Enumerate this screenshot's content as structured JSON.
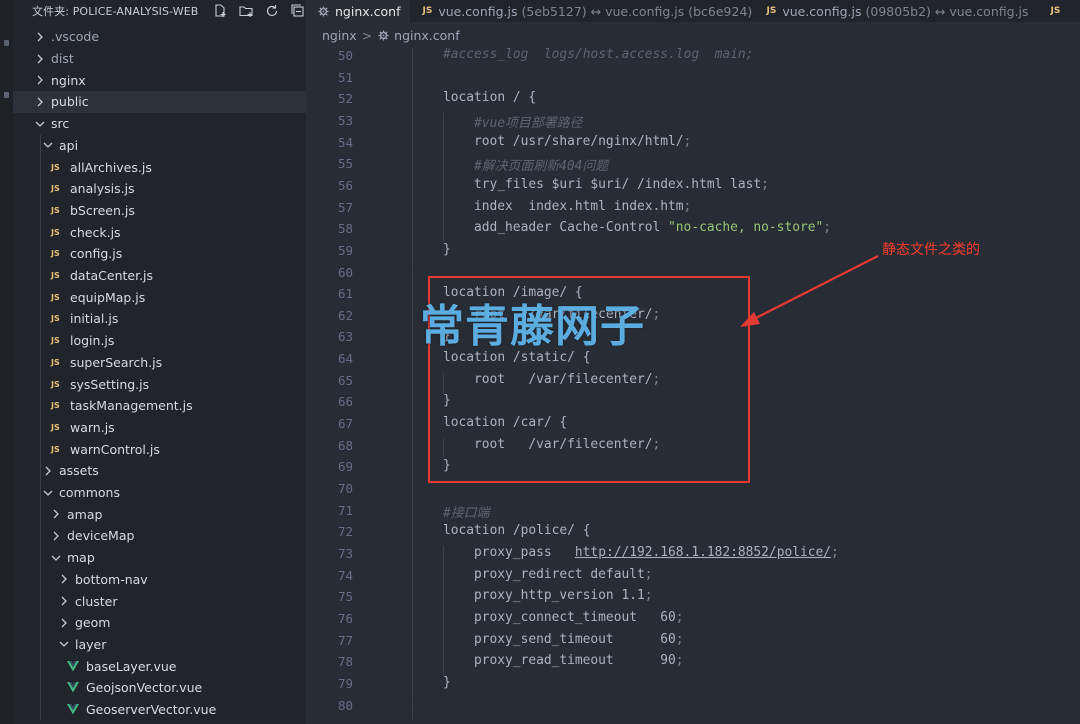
{
  "explorer": {
    "title": "文件夹: POLICE-ANALYSIS-WEB",
    "actions": [
      "new-file-icon",
      "new-folder-icon",
      "refresh-icon",
      "collapse-all-icon"
    ]
  },
  "tree": [
    {
      "label": ".vscode",
      "kind": "folder",
      "open": false,
      "depth": 0,
      "dim": true
    },
    {
      "label": "dist",
      "kind": "folder",
      "open": false,
      "depth": 0,
      "dim": true
    },
    {
      "label": "nginx",
      "kind": "folder",
      "open": false,
      "depth": 0
    },
    {
      "label": "public",
      "kind": "folder",
      "open": false,
      "depth": 0,
      "selected": true
    },
    {
      "label": "src",
      "kind": "folder",
      "open": true,
      "depth": 0
    },
    {
      "label": "api",
      "kind": "folder",
      "open": true,
      "depth": 1
    },
    {
      "label": "allArchives.js",
      "kind": "js",
      "depth": 2
    },
    {
      "label": "analysis.js",
      "kind": "js",
      "depth": 2
    },
    {
      "label": "bScreen.js",
      "kind": "js",
      "depth": 2
    },
    {
      "label": "check.js",
      "kind": "js",
      "depth": 2
    },
    {
      "label": "config.js",
      "kind": "js",
      "depth": 2
    },
    {
      "label": "dataCenter.js",
      "kind": "js",
      "depth": 2
    },
    {
      "label": "equipMap.js",
      "kind": "js",
      "depth": 2
    },
    {
      "label": "initial.js",
      "kind": "js",
      "depth": 2
    },
    {
      "label": "login.js",
      "kind": "js",
      "depth": 2
    },
    {
      "label": "superSearch.js",
      "kind": "js",
      "depth": 2
    },
    {
      "label": "sysSetting.js",
      "kind": "js",
      "depth": 2
    },
    {
      "label": "taskManagement.js",
      "kind": "js",
      "depth": 2
    },
    {
      "label": "warn.js",
      "kind": "js",
      "depth": 2
    },
    {
      "label": "warnControl.js",
      "kind": "js",
      "depth": 2
    },
    {
      "label": "assets",
      "kind": "folder",
      "open": false,
      "depth": 1
    },
    {
      "label": "commons",
      "kind": "folder",
      "open": true,
      "depth": 1
    },
    {
      "label": "amap",
      "kind": "folder",
      "open": false,
      "depth": 2
    },
    {
      "label": "deviceMap",
      "kind": "folder",
      "open": false,
      "depth": 2
    },
    {
      "label": "map",
      "kind": "folder",
      "open": true,
      "depth": 2
    },
    {
      "label": "bottom-nav",
      "kind": "folder",
      "open": false,
      "depth": 3
    },
    {
      "label": "cluster",
      "kind": "folder",
      "open": false,
      "depth": 3
    },
    {
      "label": "geom",
      "kind": "folder",
      "open": false,
      "depth": 3
    },
    {
      "label": "layer",
      "kind": "folder",
      "open": true,
      "depth": 3
    },
    {
      "label": "baseLayer.vue",
      "kind": "vue",
      "depth": 4
    },
    {
      "label": "GeojsonVector.vue",
      "kind": "vue",
      "depth": 4
    },
    {
      "label": "GeoserverVector.vue",
      "kind": "vue",
      "depth": 4
    }
  ],
  "js_badge": "JS",
  "tabs": [
    {
      "label": "nginx.conf",
      "icon": "gear-icon",
      "active": true
    },
    {
      "label": "vue.config.js",
      "suffix": "(5eb5127) ↔ vue.config.js (bc6e924)",
      "icon": "js"
    },
    {
      "label": "vue.config.js",
      "suffix": "(09805b2) ↔ vue.config.js",
      "icon": "js"
    },
    {
      "label": "",
      "icon": "js"
    }
  ],
  "breadcrumb": {
    "folder": "nginx",
    "separator": ">",
    "file": "nginx.conf"
  },
  "editor": {
    "lines": [
      {
        "n": "50",
        "ind": 1,
        "parts": [
          {
            "t": "#access_log  logs/host.access.log  main;",
            "c": "cm"
          }
        ]
      },
      {
        "n": "51",
        "ind": 1,
        "parts": []
      },
      {
        "n": "52",
        "ind": 1,
        "parts": [
          {
            "t": "location / {",
            "c": "kw"
          }
        ]
      },
      {
        "n": "53",
        "ind": 2,
        "parts": [
          {
            "t": "#vue项目部署路径",
            "c": "cm"
          }
        ]
      },
      {
        "n": "54",
        "ind": 2,
        "parts": [
          {
            "t": "root /usr/share/nginx/html/",
            "c": "kw"
          },
          {
            "t": ";",
            "c": "punc"
          }
        ]
      },
      {
        "n": "55",
        "ind": 2,
        "parts": [
          {
            "t": "#解决页面刷新404问题",
            "c": "cm"
          }
        ]
      },
      {
        "n": "56",
        "ind": 2,
        "parts": [
          {
            "t": "try_files $uri $uri/ /index.html last",
            "c": "kw"
          },
          {
            "t": ";",
            "c": "punc"
          }
        ]
      },
      {
        "n": "57",
        "ind": 2,
        "parts": [
          {
            "t": "index  index.html index.htm",
            "c": "kw"
          },
          {
            "t": ";",
            "c": "punc"
          }
        ]
      },
      {
        "n": "58",
        "ind": 2,
        "parts": [
          {
            "t": "add_header Cache-Control ",
            "c": "kw"
          },
          {
            "t": "\"no-cache, no-store\"",
            "c": "str"
          },
          {
            "t": ";",
            "c": "punc"
          }
        ]
      },
      {
        "n": "59",
        "ind": 1,
        "parts": [
          {
            "t": "}",
            "c": "kw"
          }
        ]
      },
      {
        "n": "60",
        "ind": 1,
        "parts": []
      },
      {
        "n": "61",
        "ind": 1,
        "parts": [
          {
            "t": "location /image/ {",
            "c": "kw"
          }
        ]
      },
      {
        "n": "62",
        "ind": 2,
        "parts": [
          {
            "t": "root   /var/filecenter/",
            "c": "kw"
          },
          {
            "t": ";",
            "c": "punc"
          }
        ]
      },
      {
        "n": "63",
        "ind": 1,
        "parts": [
          {
            "t": "}",
            "c": "kw"
          }
        ]
      },
      {
        "n": "64",
        "ind": 1,
        "parts": [
          {
            "t": "location /static/ {",
            "c": "kw"
          }
        ]
      },
      {
        "n": "65",
        "ind": 2,
        "parts": [
          {
            "t": "root   /var/filecenter/",
            "c": "kw"
          },
          {
            "t": ";",
            "c": "punc"
          }
        ]
      },
      {
        "n": "66",
        "ind": 1,
        "parts": [
          {
            "t": "}",
            "c": "kw"
          }
        ]
      },
      {
        "n": "67",
        "ind": 1,
        "parts": [
          {
            "t": "location /car/ {",
            "c": "kw"
          }
        ]
      },
      {
        "n": "68",
        "ind": 2,
        "parts": [
          {
            "t": "root   /var/filecenter/",
            "c": "kw"
          },
          {
            "t": ";",
            "c": "punc"
          }
        ]
      },
      {
        "n": "69",
        "ind": 1,
        "parts": [
          {
            "t": "}",
            "c": "kw"
          }
        ]
      },
      {
        "n": "70",
        "ind": 1,
        "parts": []
      },
      {
        "n": "71",
        "ind": 1,
        "parts": [
          {
            "t": "#接口端",
            "c": "cm"
          }
        ]
      },
      {
        "n": "72",
        "ind": 1,
        "parts": [
          {
            "t": "location /police/ {",
            "c": "kw"
          }
        ]
      },
      {
        "n": "73",
        "ind": 2,
        "parts": [
          {
            "t": "proxy_pass   ",
            "c": "kw"
          },
          {
            "t": "http://192.168.1.182:8852/police/",
            "c": "url"
          },
          {
            "t": ";",
            "c": "punc"
          }
        ]
      },
      {
        "n": "74",
        "ind": 2,
        "parts": [
          {
            "t": "proxy_redirect default",
            "c": "kw"
          },
          {
            "t": ";",
            "c": "punc"
          }
        ]
      },
      {
        "n": "75",
        "ind": 2,
        "parts": [
          {
            "t": "proxy_http_version 1.1",
            "c": "kw"
          },
          {
            "t": ";",
            "c": "punc"
          }
        ]
      },
      {
        "n": "76",
        "ind": 2,
        "parts": [
          {
            "t": "proxy_connect_timeout   60",
            "c": "kw"
          },
          {
            "t": ";",
            "c": "punc"
          }
        ]
      },
      {
        "n": "77",
        "ind": 2,
        "parts": [
          {
            "t": "proxy_send_timeout      60",
            "c": "kw"
          },
          {
            "t": ";",
            "c": "punc"
          }
        ]
      },
      {
        "n": "78",
        "ind": 2,
        "parts": [
          {
            "t": "proxy_read_timeout      90",
            "c": "kw"
          },
          {
            "t": ";",
            "c": "punc"
          }
        ]
      },
      {
        "n": "79",
        "ind": 1,
        "parts": [
          {
            "t": "}",
            "c": "kw"
          }
        ]
      },
      {
        "n": "80",
        "ind": 1,
        "parts": []
      }
    ]
  },
  "annotation": {
    "label": "静态文件之类的",
    "color": "#e53935"
  },
  "watermark": "常青藤网子"
}
